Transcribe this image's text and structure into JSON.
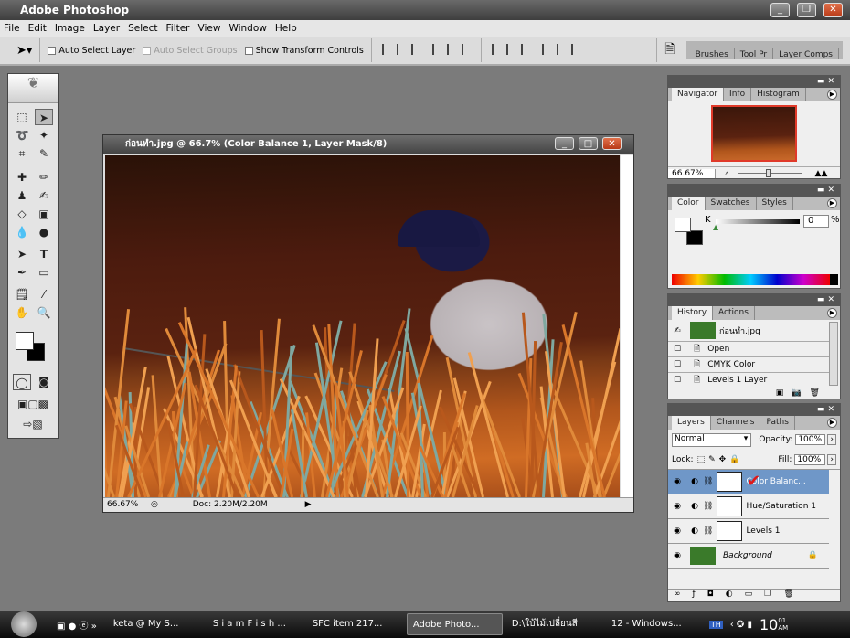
{
  "app": {
    "title": "Adobe Photoshop"
  },
  "menu": [
    "File",
    "Edit",
    "Image",
    "Layer",
    "Select",
    "Filter",
    "View",
    "Window",
    "Help"
  ],
  "options": {
    "auto_select_layer": "Auto Select Layer",
    "auto_select_groups": "Auto Select Groups",
    "show_transform": "Show Transform Controls",
    "palette_tabs": [
      "Brushes",
      "Tool Pr",
      "Layer Comps"
    ]
  },
  "document": {
    "title": "ก่อนทำ.jpg @ 66.7% (Color Balance 1, Layer Mask/8)",
    "zoom": "66.67%",
    "doc_size": "Doc: 2.20M/2.20M"
  },
  "navigator": {
    "tabs": [
      "Navigator",
      "Info",
      "Histogram"
    ],
    "zoom": "66.67%"
  },
  "color": {
    "tabs": [
      "Color",
      "Swatches",
      "Styles"
    ],
    "channel": "K",
    "value": "0",
    "unit": "%"
  },
  "history": {
    "tabs": [
      "History",
      "Actions"
    ],
    "snapshot": "ก่อนทำ.jpg",
    "items": [
      "Open",
      "CMYK Color",
      "Levels 1 Layer"
    ]
  },
  "layers": {
    "tabs": [
      "Layers",
      "Channels",
      "Paths"
    ],
    "blend_mode": "Normal",
    "opacity_label": "Opacity:",
    "opacity": "100%",
    "lock_label": "Lock:",
    "fill_label": "Fill:",
    "fill": "100%",
    "items": [
      {
        "name": "Color Balanc...",
        "selected": true
      },
      {
        "name": "Hue/Saturation 1"
      },
      {
        "name": "Levels 1"
      },
      {
        "name": "Background",
        "locked": true
      }
    ]
  },
  "taskbar": {
    "items": [
      "keta @ My S...",
      "S i a m F i s h ...",
      "SFC item 217...",
      "Adobe Photo...",
      "D:\\ใบ้ไม้เปลี่ยนสี",
      "12 - Windows..."
    ],
    "active": 3,
    "lang": "TH",
    "clock_hour": "10",
    "clock_min": "01",
    "clock_ampm": "AM"
  },
  "colors": {
    "selection": "#6f97c8",
    "workspace": "#7b7b7b"
  }
}
